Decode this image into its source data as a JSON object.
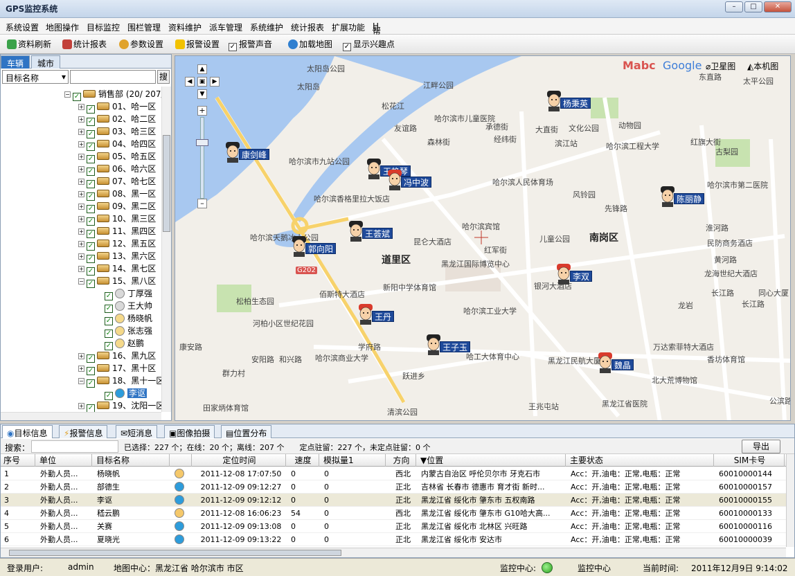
{
  "app": {
    "title": "GPS监控系统"
  },
  "menu": [
    "系统设置",
    "地图操作",
    "目标监控",
    "围栏管理",
    "资料维护",
    "派车管理",
    "系统维护",
    "统计报表",
    "扩展功能",
    "帮助"
  ],
  "help_suffix": "H",
  "toolbar": {
    "refresh": "资料刷新",
    "report": "统计报表",
    "params": "参数设置",
    "alarm_settings": "报警设置",
    "alarm_sound": "报警声音",
    "load_map": "加载地图",
    "show_poi": "显示兴趣点"
  },
  "left": {
    "tabs": [
      "车辆",
      "城市"
    ],
    "search_field": "目标名称",
    "search_button": "搜"
  },
  "tree": {
    "root": "销售部 (20/ 207/",
    "groups": [
      "01、哈一区",
      "02、哈二区",
      "03、哈三区",
      "04、哈四区",
      "05、哈五区",
      "06、哈六区",
      "07、哈七区",
      "08、黑一区",
      "09、黑二区",
      "10、黑三区",
      "11、黑四区",
      "12、黑五区",
      "13、黑六区",
      "14、黑七区",
      "15、黑八区"
    ],
    "members15": [
      "丁厚强",
      "王大帅",
      "杨晓帆",
      "张志强",
      "赵鹏"
    ],
    "groups2": [
      "16、黑九区",
      "17、黑十区",
      "18、黑十一区"
    ],
    "members18": [
      "李讴"
    ],
    "group19": "19、沈阳一区"
  },
  "map": {
    "controls": {
      "satellite": "卫星图",
      "local": "本机图"
    },
    "logos": [
      "Mabc",
      "Google"
    ],
    "districts": [
      "道里区",
      "南岗区"
    ],
    "labels": [
      "太阳岛公园",
      "太阳岛",
      "江畔公园",
      "松花江",
      "哈尔滨市儿童医院",
      "友谊路",
      "森林街",
      "经纬街",
      "承德街",
      "大直街",
      "动物园",
      "文化公园",
      "滨江站",
      "哈尔滨工程大学",
      "古梨园",
      "红旗大街",
      "太平公园",
      "东直路",
      "哈尔滨市第二医院",
      "先锋路",
      "淮河路",
      "民防商务酒店",
      "黄河路",
      "龙海世纪大酒店",
      "长江路",
      "同心大厦",
      "哈尔滨市九站公园",
      "哈尔滨香格里拉大饭店",
      "哈尔滨人民体育场",
      "风铃园",
      "哈尔滨宾馆",
      "红军街",
      "昆仑大酒店",
      "儿童公园",
      "黑龙江国际博览中心",
      "哈尔滨工业大学",
      "新阳中学体育馆",
      "佰斯特大酒店",
      "松柏生态园",
      "河柏小区世纪花园",
      "哈尔滨商业大学",
      "哈工大体育中心",
      "黑龙江民航大厦",
      "万达索菲特大酒店",
      "香坊体育馆",
      "北大荒博物馆",
      "黑龙江省医院",
      "王兆屯站",
      "清滨公园",
      "田家炳体育馆",
      "康安路",
      "群力村",
      "安阳路",
      "和兴路",
      "跃进乡",
      "学府路",
      "哈尔滨天鹅冰上公园",
      "公滨路",
      "银河大酒店",
      "龙岩",
      "长江路",
      "黑龙江 G202"
    ],
    "road_badge": "G202",
    "vehicles": [
      "杨秉英",
      "康剑峰",
      "王艳琴",
      "冯中波",
      "王荟斌",
      "郭向阳",
      "李双",
      "陈丽静",
      "王丹",
      "王子玉",
      "魏晶"
    ]
  },
  "bottom": {
    "tabs": [
      "目标信息",
      "报警信息",
      "短消息",
      "图像拍摄",
      "位置分布"
    ],
    "search_label": "搜索：",
    "summary": "已选择：227 个；在线：20 个；离线：207 个　　定点驻留：227 个，未定点驻留：0 个",
    "export": "导出",
    "columns": [
      "序号",
      "单位",
      "目标名称",
      "",
      "定位时间",
      "速度",
      "模拟量1",
      "方向",
      "▼位置",
      "主要状态",
      "SIM卡号"
    ],
    "rows": [
      [
        "1",
        "外勤人员...",
        "杨晓帆",
        "yellow",
        "2011-12-08 17:07:50",
        "0",
        "0",
        "西北",
        "内蒙古自治区 呼伦贝尔市 牙克石市",
        "Acc：开,油电：正常,电瓶：正常",
        "60010000144"
      ],
      [
        "2",
        "外勤人员...",
        "部德生",
        "blue",
        "2011-12-09 09:12:27",
        "0",
        "0",
        "正北",
        "吉林省 长春市 德惠市 育才街 新时...",
        "Acc：开,油电：正常,电瓶：正常",
        "60010000157"
      ],
      [
        "3",
        "外勤人员...",
        "李讴",
        "blue",
        "2011-12-09 09:12:12",
        "0",
        "0",
        "正北",
        "黑龙江省 绥化市 肇东市 五权南路",
        "Acc：开,油电：正常,电瓶：正常",
        "60010000155"
      ],
      [
        "4",
        "外勤人员...",
        "嵇云鹏",
        "yellow",
        "2011-12-08 16:06:23",
        "54",
        "0",
        "西北",
        "黑龙江省 绥化市 肇东市 G10哈大高...",
        "Acc：开,油电：正常,电瓶：正常",
        "60010000133"
      ],
      [
        "5",
        "外勤人员...",
        "关赛",
        "blue",
        "2011-12-09 09:13:08",
        "0",
        "0",
        "正北",
        "黑龙江省 绥化市 北林区 兴旺路",
        "Acc：开,油电：正常,电瓶：正常",
        "60010000116"
      ],
      [
        "6",
        "外勤人员...",
        "夏晓光",
        "blue",
        "2011-12-09 09:13:22",
        "0",
        "0",
        "正北",
        "黑龙江省 绥化市 安达市",
        "Acc：开,油电：正常,电瓶：正常",
        "60010000039"
      ]
    ]
  },
  "status": {
    "login_label": "登录用户:",
    "login_user": "admin",
    "map_center": "地图中心：黑龙江省 哈尔滨市 市区",
    "monitor_label": "监控中心:",
    "monitor_name": "监控中心",
    "time_label": "当前时间:",
    "time_value": "2011年12月9日 9:14:02"
  },
  "colors": {
    "accent": "#2f74c4",
    "online": "#2d9cdb",
    "offline": "#f5c86a",
    "vehicle_label": "#1f4a9a"
  }
}
